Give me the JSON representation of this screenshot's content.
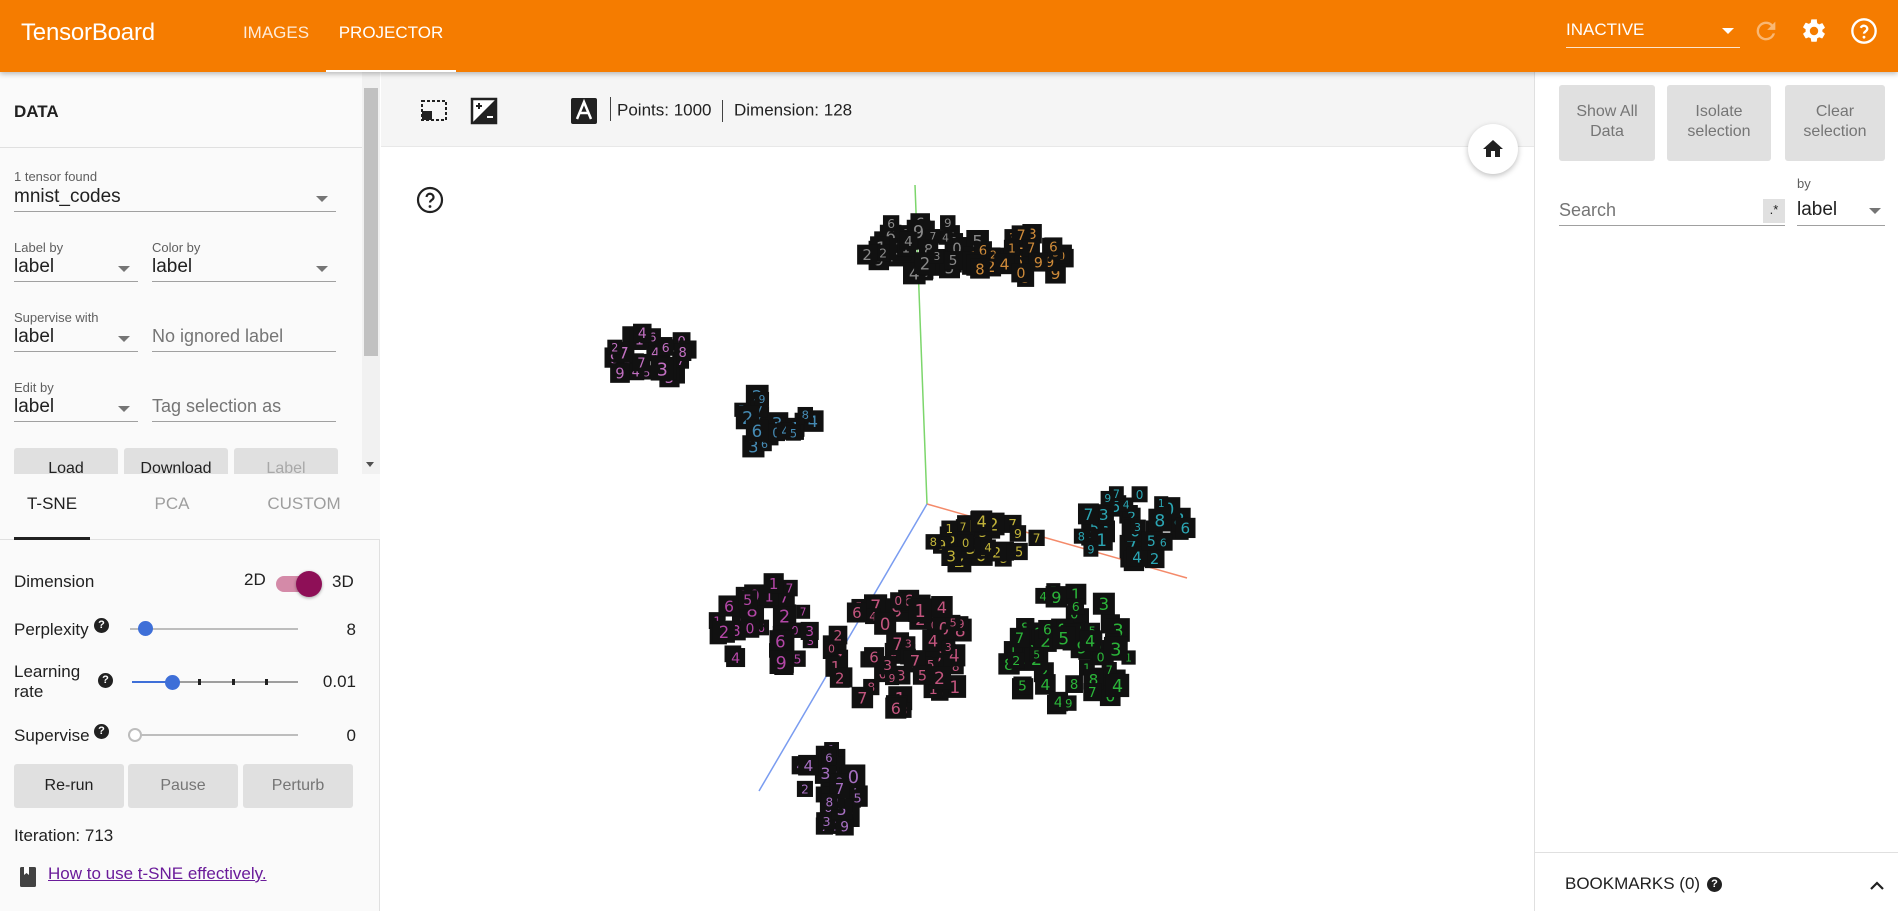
{
  "header": {
    "brand": "TensorBoard",
    "tabs": [
      {
        "label": "IMAGES",
        "active": false
      },
      {
        "label": "PROJECTOR",
        "active": true
      }
    ],
    "run_status": "INACTIVE",
    "icons": [
      "reload-icon",
      "settings-icon",
      "help-icon"
    ],
    "accent_color": "#f57c00"
  },
  "data_panel": {
    "title": "DATA",
    "tensor_count_label": "1 tensor found",
    "tensor_value": "mnist_codes",
    "label_by": {
      "label": "Label by",
      "value": "label"
    },
    "color_by": {
      "label": "Color by",
      "value": "label"
    },
    "supervise_with": {
      "label": "Supervise with",
      "value": "label"
    },
    "ignored_label_placeholder": "No ignored label",
    "edit_by": {
      "label": "Edit by",
      "value": "label"
    },
    "tag_selection_placeholder": "Tag selection as",
    "buttons": {
      "load": "Load",
      "download": "Download",
      "label": "Label"
    }
  },
  "projection_tabs": [
    {
      "label": "T-SNE",
      "active": true
    },
    {
      "label": "PCA",
      "active": false
    },
    {
      "label": "CUSTOM",
      "active": false
    }
  ],
  "tsne": {
    "dimension_label": "Dimension",
    "dim_2d": "2D",
    "dim_3d": "3D",
    "dimension_toggle_on": true,
    "perplexity_label": "Perplexity",
    "perplexity_value": "8",
    "perplexity_fraction": 0.05,
    "learning_rate_label": "Learning rate",
    "learning_rate_value": "0.01",
    "learning_rate_fraction": 0.2,
    "supervise_label": "Supervise",
    "supervise_value": "0",
    "supervise_fraction": 0.0,
    "buttons": {
      "rerun": "Re-run",
      "pause": "Pause",
      "perturb": "Perturb"
    },
    "iteration_text": "Iteration: 713",
    "help_link": "How to use t-SNE effectively."
  },
  "toolbar": {
    "icons": [
      "selection-box-icon",
      "night-mode-toggle-icon",
      "dark-theme-icon",
      "labels-toggle-icon"
    ],
    "points_text": "Points: 1000",
    "dimension_text": "Dimension: 128"
  },
  "inspector": {
    "show_all": "Show All Data",
    "isolate": "Isolate selection",
    "clear": "Clear selection",
    "search_placeholder": "Search",
    "regex_label": ".*",
    "by_label": "by",
    "by_value": "label",
    "bookmarks_label": "BOOKMARKS (0)"
  }
}
